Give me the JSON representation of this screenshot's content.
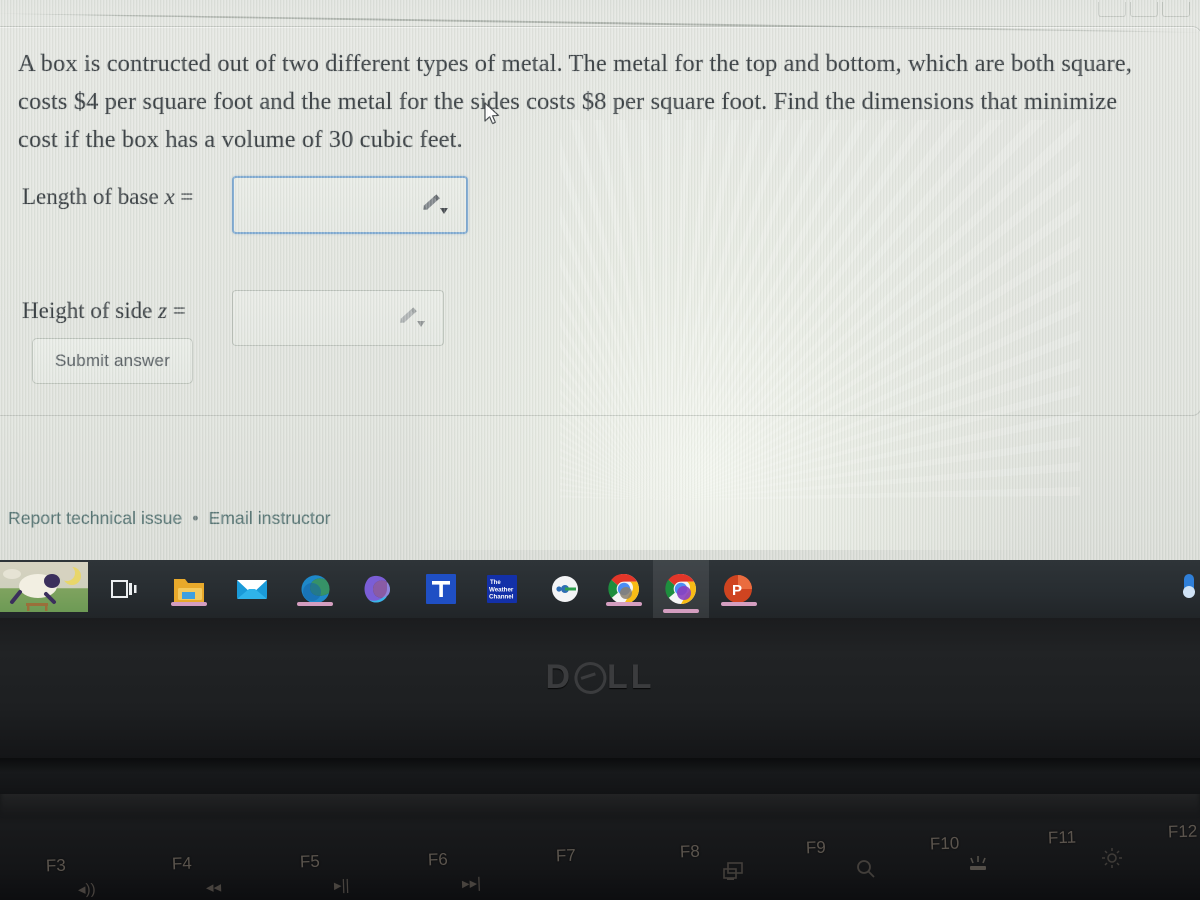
{
  "screen": {
    "problem_text": "A box is contructed out of two different types of metal. The metal for the top and bottom, which are both square, costs $4 per square foot and the metal for the sides costs $8 per square foot. Find the dimensions that minimize cost if the box has a volume of 30 cubic feet.",
    "answers": [
      {
        "label_prefix": "Length of base ",
        "variable": "x",
        "label_suffix": " =",
        "value": "",
        "placeholder": "",
        "focused": true,
        "tool_icon": "pencil-dropdown-icon"
      },
      {
        "label_prefix": "Height of side ",
        "variable": "z",
        "label_suffix": " =",
        "value": "",
        "placeholder": "",
        "focused": false,
        "tool_icon": "pencil-dropdown-icon"
      }
    ],
    "submit_label": "Submit answer",
    "footer": {
      "report_label": "Report technical issue",
      "separator": "•",
      "email_label": "Email instructor"
    },
    "cursor_icon": "mouse-pointer-icon"
  },
  "taskbar": {
    "weather_widget": {
      "name": "sheep-weather-widget",
      "icons": [
        "sheep-icon",
        "crescent-moon-icon",
        "cloud-icon"
      ]
    },
    "items": [
      {
        "name": "task-view",
        "icon": "task-view-icon",
        "label": "Task View",
        "active": false,
        "running": false
      },
      {
        "name": "file-explorer",
        "icon": "folder-icon",
        "label": "File Explorer",
        "active": false,
        "running": true
      },
      {
        "name": "mail",
        "icon": "envelope-icon",
        "label": "Mail",
        "active": false,
        "running": false
      },
      {
        "name": "microsoft-edge",
        "icon": "edge-icon",
        "label": "Microsoft Edge",
        "active": false,
        "running": true
      },
      {
        "name": "microsoft-365",
        "icon": "office-icon",
        "label": "Microsoft 365",
        "active": false,
        "running": false
      },
      {
        "name": "microsoft-teams",
        "icon": "teams-icon",
        "label": "T",
        "active": false,
        "running": false
      },
      {
        "name": "weather-channel",
        "icon": "weather-channel-icon",
        "label": "The Weather Channel",
        "active": false,
        "running": false
      },
      {
        "name": "media-player",
        "icon": "disc-icon",
        "label": "Media",
        "active": false,
        "running": false
      },
      {
        "name": "google-chrome-1",
        "icon": "chrome-icon",
        "label": "Google Chrome",
        "active": false,
        "running": true
      },
      {
        "name": "google-chrome-2",
        "icon": "chrome-icon",
        "label": "Google Chrome",
        "active": true,
        "running": true
      },
      {
        "name": "powerpoint",
        "icon": "powerpoint-icon",
        "label": "P",
        "active": false,
        "running": true
      }
    ],
    "system_tray": {
      "name": "tray-icon",
      "icon": "blue-tray-icon"
    }
  },
  "chassis": {
    "brand": "DELL",
    "brand_left": "D",
    "brand_right": "LL"
  },
  "keyboard": {
    "function_keys": [
      {
        "label": "F3",
        "glyph": "volume-down-icon",
        "glyph_char": "◂))"
      },
      {
        "label": "F4",
        "glyph": "previous-track-icon",
        "glyph_char": "◂◂"
      },
      {
        "label": "F5",
        "glyph": "play-pause-icon",
        "glyph_char": "▸||"
      },
      {
        "label": "F6",
        "glyph": "next-track-icon",
        "glyph_char": "▸▸|"
      },
      {
        "label": "F7",
        "glyph": "",
        "glyph_char": ""
      },
      {
        "label": "F8",
        "glyph": "display-switch-icon",
        "glyph_char": ""
      },
      {
        "label": "F9",
        "glyph": "search-icon",
        "glyph_char": ""
      },
      {
        "label": "F10",
        "glyph": "keyboard-backlight-icon",
        "glyph_char": ""
      },
      {
        "label": "F11",
        "glyph": "brightness-icon",
        "glyph_char": ""
      },
      {
        "label": "F12",
        "glyph": "",
        "glyph_char": ""
      }
    ]
  },
  "colors": {
    "screen_bg": "#e1e4de",
    "text": "#32383c",
    "focus_border": "#7ba7d0",
    "link": "#51706f",
    "taskbar_bg": "#2a3034",
    "taskbar_indicator": "#d49ec0",
    "dell_logo": "#3b3c3e",
    "fkey_text": "#6a6259"
  }
}
